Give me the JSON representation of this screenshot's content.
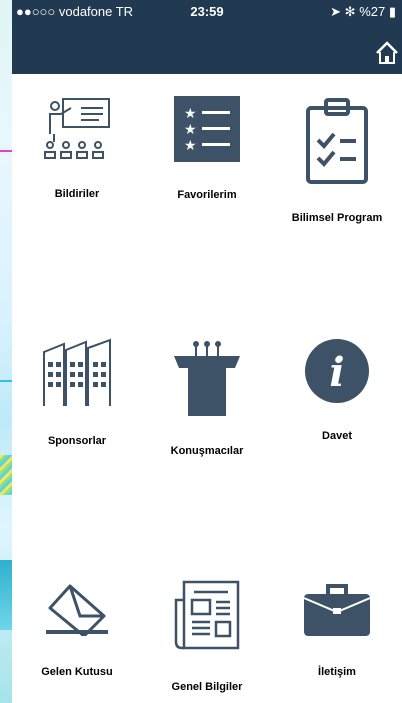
{
  "status_bar": {
    "carrier": "●●○○○ vodafone TR",
    "time": "23:59",
    "battery": "%27"
  },
  "colors": {
    "header": "#213a52",
    "icon": "#3d5266"
  },
  "menu": [
    {
      "label": "Bildiriler",
      "icon": "presentation-icon"
    },
    {
      "label": "Favorilerim",
      "icon": "star-list-icon"
    },
    {
      "label": "Bilimsel Program",
      "icon": "clipboard-checklist-icon"
    },
    {
      "label": "Sponsorlar",
      "icon": "buildings-icon"
    },
    {
      "label": "Konuşmacılar",
      "icon": "podium-icon"
    },
    {
      "label": "Davet",
      "icon": "info-icon"
    },
    {
      "label": "Gelen Kutusu",
      "icon": "envelope-icon"
    },
    {
      "label": "Genel Bilgiler",
      "icon": "newspaper-icon"
    },
    {
      "label": "İletişim",
      "icon": "briefcase-icon"
    }
  ]
}
